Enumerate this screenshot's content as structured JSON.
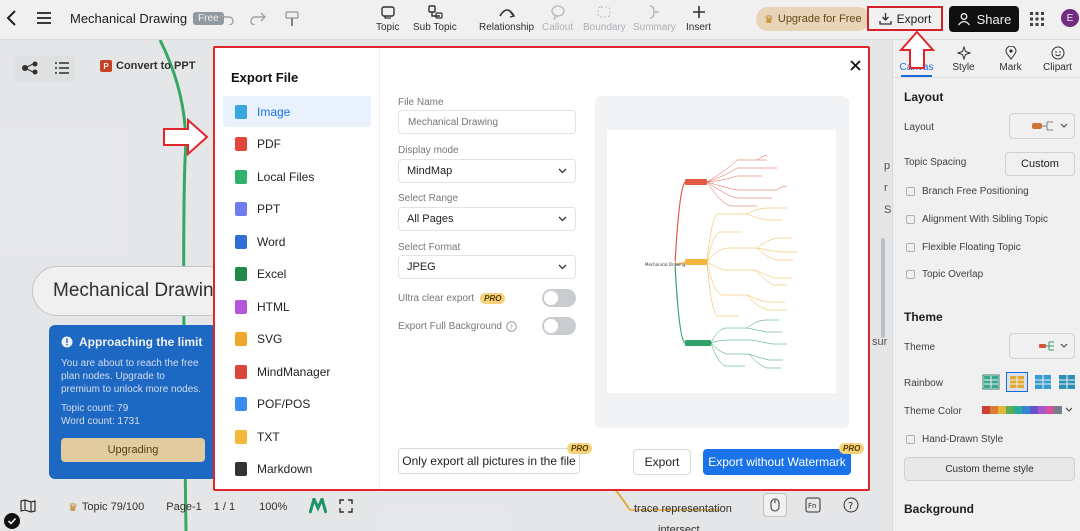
{
  "header": {
    "title": "Mechanical Drawing",
    "plan_badge": "Free",
    "tools": [
      {
        "label": "Topic",
        "icon": "topic-icon"
      },
      {
        "label": "Sub Topic",
        "icon": "subtopic-icon"
      },
      {
        "label": "Relationship",
        "icon": "relationship-icon"
      },
      {
        "label": "Callout",
        "icon": "callout-icon"
      },
      {
        "label": "Boundary",
        "icon": "boundary-icon"
      },
      {
        "label": "Summary",
        "icon": "summary-icon"
      },
      {
        "label": "Insert",
        "icon": "plus-icon"
      }
    ],
    "upgrade_label": "Upgrade for Free",
    "export_label": "Export",
    "share_label": "Share",
    "avatar_initial": "E"
  },
  "canvas": {
    "convert_label": "Convert to PPT",
    "root_topic": "Mechanical Drawing",
    "warning": {
      "title": "Approaching the limit",
      "body": "You are about to reach the free plan nodes. Upgrade to premium to unlock more nodes.",
      "topic_count": "Topic count:  79",
      "word_count": "Word count:  1731",
      "button": "Upgrading"
    },
    "bottom": {
      "topic_status": "Topic 79/100",
      "page": "Page-1",
      "page_count": "1 / 1",
      "zoom": "100%"
    },
    "peek": {
      "trace": "trace representation",
      "intersect": "intersect",
      "p": "p",
      "r": "r",
      "s": "S",
      "sur": "sur"
    }
  },
  "right_panel": {
    "tabs": [
      "Canvas",
      "Style",
      "Mark",
      "Clipart"
    ],
    "layout_heading": "Layout",
    "layout_label": "Layout",
    "topic_spacing_label": "Topic Spacing",
    "custom_label": "Custom",
    "options": [
      "Branch Free Positioning",
      "Alignment With Sibling Topic",
      "Flexible Floating Topic",
      "Topic Overlap"
    ],
    "theme_heading": "Theme",
    "theme_label": "Theme",
    "rainbow_label": "Rainbow",
    "theme_color_label": "Theme Color",
    "hand_drawn_label": "Hand-Drawn Style",
    "custom_theme_label": "Custom theme style",
    "background_heading": "Background"
  },
  "export_modal": {
    "title": "Export File",
    "formats": [
      {
        "label": "Image",
        "icon": "image-file-icon",
        "color": "#3aa7e0"
      },
      {
        "label": "PDF",
        "icon": "pdf-file-icon",
        "color": "#e2463a"
      },
      {
        "label": "Local Files",
        "icon": "local-file-icon",
        "color": "#2fb36b"
      },
      {
        "label": "PPT",
        "icon": "ppt-file-icon",
        "color": "#6f7cf0"
      },
      {
        "label": "Word",
        "icon": "word-file-icon",
        "color": "#2f6fd6"
      },
      {
        "label": "Excel",
        "icon": "excel-file-icon",
        "color": "#1e8a46"
      },
      {
        "label": "HTML",
        "icon": "html-file-icon",
        "color": "#b556d8"
      },
      {
        "label": "SVG",
        "icon": "svg-file-icon",
        "color": "#f0a72c"
      },
      {
        "label": "MindManager",
        "icon": "mindmanager-file-icon",
        "color": "#d9453a"
      },
      {
        "label": "POF/POS",
        "icon": "pof-file-icon",
        "color": "#3b8ef0"
      },
      {
        "label": "TXT",
        "icon": "txt-file-icon",
        "color": "#f2b93a"
      },
      {
        "label": "Markdown",
        "icon": "markdown-file-icon",
        "color": "#333333"
      }
    ],
    "file_name_label": "File Name",
    "file_name_placeholder": "Mechanical Drawing",
    "display_mode_label": "Display mode",
    "display_mode_value": "MindMap",
    "select_range_label": "Select Range",
    "select_range_value": "All Pages",
    "select_format_label": "Select Format",
    "select_format_value": "JPEG",
    "ultra_clear_label": "Ultra clear export",
    "full_bg_label": "Export Full Background",
    "pro_label": "PRO",
    "export_pictures_label": "Only export all pictures in the file",
    "export_label": "Export",
    "export_no_watermark_label": "Export without Watermark",
    "preview": {
      "root": "Mechanical Drawing",
      "branch_colors": [
        "#e25b45",
        "#f3b53f",
        "#2fa36b"
      ]
    }
  }
}
